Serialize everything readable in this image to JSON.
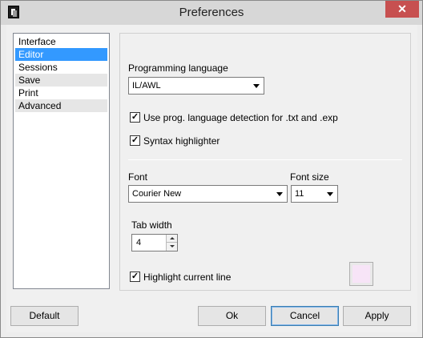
{
  "window": {
    "title": "Preferences",
    "close_glyph": "✕",
    "app_icon": "app-logo-icon",
    "close_icon": "close-icon"
  },
  "categories": [
    {
      "label": "Interface",
      "selected": false
    },
    {
      "label": "Editor",
      "selected": true
    },
    {
      "label": "Sessions",
      "selected": false
    },
    {
      "label": "Save",
      "selected": false
    },
    {
      "label": "Print",
      "selected": false
    },
    {
      "label": "Advanced",
      "selected": false
    }
  ],
  "editor": {
    "language_label": "Programming language",
    "language_value": "IL/AWL",
    "autodetect_label": "Use prog. language detection for .txt and .exp",
    "autodetect_checked": true,
    "syntax_label": "Syntax highlighter",
    "syntax_checked": true,
    "font_label": "Font",
    "font_value": "Courier New",
    "font_size_label": "Font size",
    "font_size_value": "11",
    "tab_width_label": "Tab width",
    "tab_width_value": "4",
    "highlight_label": "Highlight current line",
    "highlight_checked": true,
    "highlight_color": "#f7e4f7",
    "check_glyph": "✓"
  },
  "buttons": {
    "default": "Default",
    "ok": "Ok",
    "cancel": "Cancel",
    "apply": "Apply"
  },
  "colors": {
    "selection": "#3399ff",
    "close": "#c75050"
  }
}
